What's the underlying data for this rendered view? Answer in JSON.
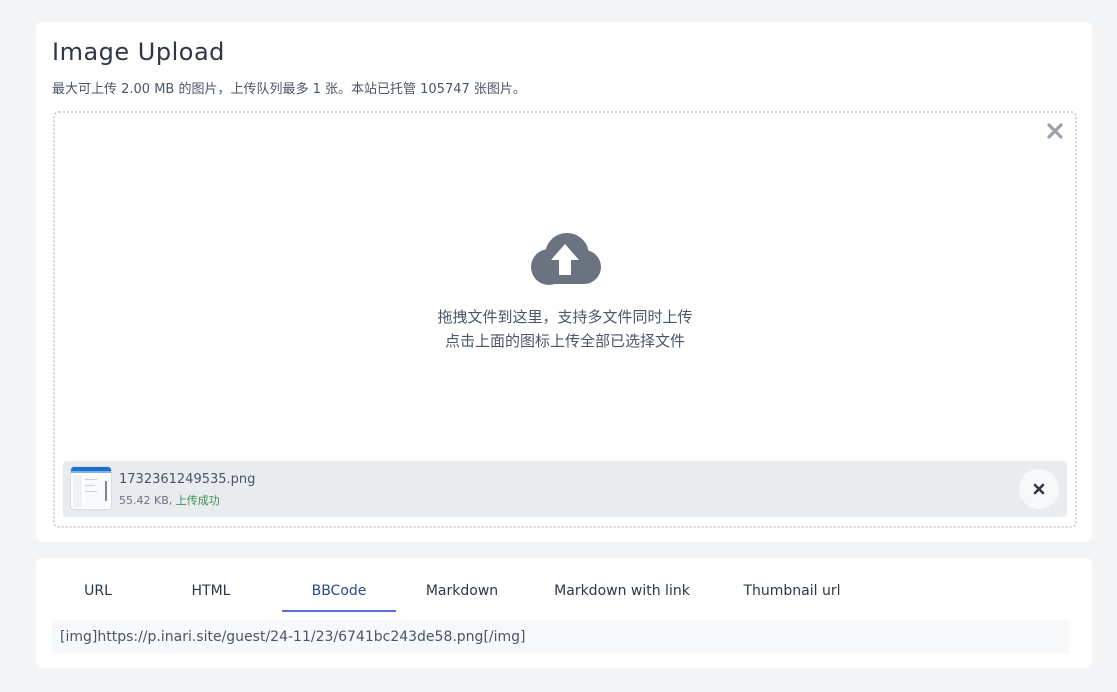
{
  "upload": {
    "title": "Image Upload",
    "subtitle": "最大可上传 2.00 MB 的图片，上传队列最多 1 张。本站已托管 105747 张图片。",
    "dropzone": {
      "line1": "拖拽文件到这里，支持多文件同时上传",
      "line2": "点击上面的图标上传全部已选择文件",
      "close_icon": "close-icon",
      "upload_icon": "cloud-upload-icon"
    },
    "file": {
      "name": "1732361249535.png",
      "size": "55.42 KB,",
      "status": "上传成功",
      "status_color": "#3f8f5a",
      "remove_icon": "close-icon"
    }
  },
  "links": {
    "tabs": [
      {
        "label": "URL"
      },
      {
        "label": "HTML"
      },
      {
        "label": "BBCode"
      },
      {
        "label": "Markdown"
      },
      {
        "label": "Markdown with link"
      },
      {
        "label": "Thumbnail url"
      }
    ],
    "active_tab": "BBCode",
    "accent_color": "#5b6ee1",
    "value": "[img]https://p.inari.site/guest/24-11/23/6741bc243de58.png[/img]"
  }
}
